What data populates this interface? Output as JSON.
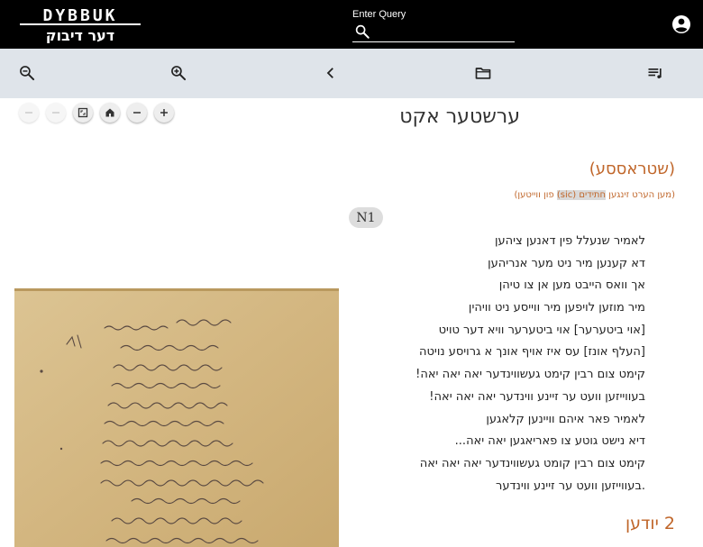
{
  "header": {
    "logo_text_top": "DYBBUK",
    "logo_text_bottom": "דער דיבוק",
    "query_label": "Enter Query",
    "query_value": "",
    "query_placeholder": "",
    "account_icon": "account-circle-icon"
  },
  "toolbar": {
    "icons": [
      "zoom-out-icon",
      "zoom-in-icon",
      "chevron-left-icon",
      "folder-icon",
      "playlist-icon"
    ]
  },
  "viewer_controls": {
    "icons": [
      "rotate-left-icon",
      "rotate-right-icon",
      "fullscreen-icon",
      "home-icon",
      "zoom-out-icon",
      "zoom-in-icon"
    ]
  },
  "text": {
    "act_title": "ערשטער אקט",
    "speaker": "(שטראססע)",
    "stage_before": "(מען הערט זינגען ",
    "stage_highlight": "חתידים (sic)",
    "stage_after": " פון ווייטען)",
    "number_badge": "N1",
    "lines": [
      "לאמיר שנעלל פין דאנען ציהען",
      "דא קענען מיר ניט מער אנריהען",
      "אך וואס הייבט מען אן צו טיהן",
      "מיר מוזען לויפען מיר ווייסע ניט וויהין",
      "[אוי ביטערער] אוי ביטערער וויא דער טויט",
      "[העלף אונז] עס איז אויף אונך א גרויסע נויטה",
      "קימט צום רבין קימט געשווינדער יאה יאה יאה!",
      "בעווייזען וועט ער זיינע ווינדער יאה יאה יאה!",
      "לאמיר פאר איהם וויינען קלאגען",
      "דיא נישט גוטע צו פאריאגען יאה יאה...",
      "קימט צום רבין קומט געשווינדער יאה יאה יאה",
      ".בעווייזען וועט ער זיינע ווינדער"
    ],
    "section_heading": "2 יודען"
  },
  "colors": {
    "topbar": "#000000",
    "toolbar": "#dfe4ea",
    "accent": "#c0662a",
    "paper": "#d9bf8c"
  }
}
